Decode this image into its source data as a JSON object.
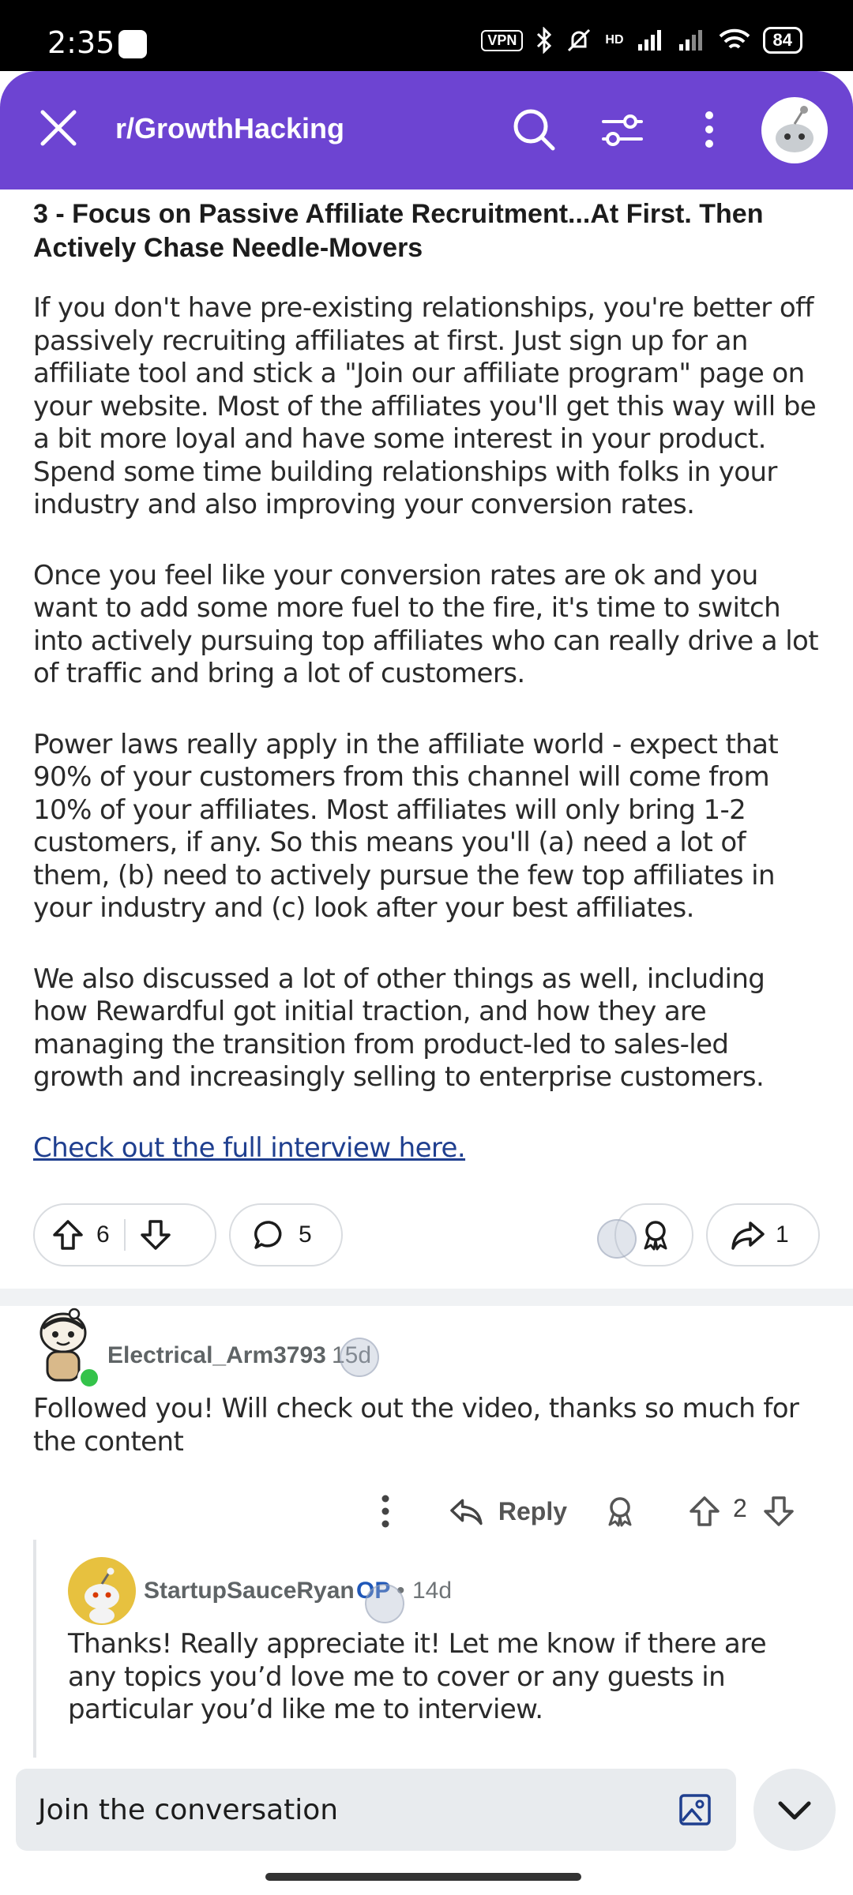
{
  "status_bar": {
    "time": "2:35",
    "vpn": "VPN",
    "battery": "84",
    "network": "HD"
  },
  "header": {
    "title": "r/GrowthHacking",
    "accent_color": "#6d44d2"
  },
  "post": {
    "section_heading": "3 - Focus on Passive Affiliate Recruitment...At First. Then Actively Chase Needle-Movers",
    "paragraphs": [
      "If you don't have pre-existing relationships, you're better off passively recruiting affiliates at first. Just sign up for an affiliate tool and stick a \"Join our affiliate program\" page on your website. Most of the affiliates you'll get this way will be a bit more loyal and have some interest in your product. Spend some time building relationships with folks in your industry and also improving your conversion rates.",
      "Once you feel like your conversion rates are ok and you want to add some more fuel to the fire, it's time to switch into actively pursuing top affiliates who can really drive a lot of traffic and bring a lot of customers.",
      "Power laws really apply in the affiliate world - expect that 90% of your customers from this channel will come from 10% of your affiliates. Most affiliates will only bring 1-2 customers, if any. So this means you'll (a) need a lot of them, (b) need to actively pursue the few top affiliates in your industry and (c) look after your best affiliates.",
      "We also discussed a lot of other things as well, including how Rewardful got initial traction, and how they are managing the transition from product-led to sales-led growth and increasingly selling to enterprise customers."
    ],
    "link_text": "Check out the full interview here.",
    "upvotes": "6",
    "comments": "5",
    "shares": "1"
  },
  "comments": [
    {
      "username": "Electrical_Arm3793",
      "age": "15d",
      "text": "Followed you! Will check out the video, thanks so much for the content",
      "reply_label": "Reply",
      "score": "2"
    },
    {
      "username": "StartupSauceRyan",
      "op_badge": "OP",
      "separator": "•",
      "age": "14d",
      "text": "Thanks! Really appreciate it! Let me know if there are any topics you’d love me to cover or any guests in particular you’d like me to interview."
    }
  ],
  "composer": {
    "placeholder": "Join the conversation"
  }
}
